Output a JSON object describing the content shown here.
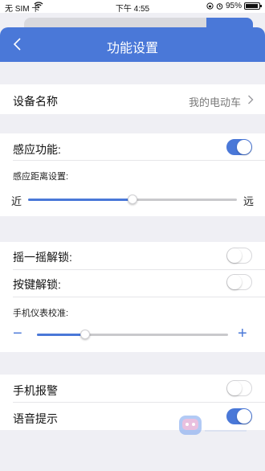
{
  "status_bar": {
    "carrier": "无 SIM 卡",
    "time": "下午 4:55",
    "battery": "95%",
    "icons": [
      "wifi-icon",
      "alarm-icon",
      "lock-rotation-icon",
      "battery-icon"
    ]
  },
  "nav": {
    "title": "功能设置",
    "back_icon": "chevron-left-icon"
  },
  "device": {
    "label": "设备名称",
    "value": "我的电动车"
  },
  "sensing": {
    "label": "感应功能:",
    "toggle_on": true,
    "distance_label": "感应距离设置:",
    "near": "近",
    "far": "远",
    "distance_level": 0.5
  },
  "unlock": {
    "shake_label": "摇一摇解锁:",
    "shake_on": false,
    "button_label": "按键解锁:",
    "button_on": false,
    "calibration_label": "手机仪表校准:",
    "minus": "−",
    "plus": "+",
    "calibration_level": 0.25
  },
  "alerts": {
    "phone_alarm_label": "手机报警",
    "phone_alarm_on": false,
    "voice_prompt_label": "语音提示",
    "voice_prompt_on": true
  },
  "colors": {
    "accent": "#4a78d8",
    "background": "#efeff4"
  }
}
